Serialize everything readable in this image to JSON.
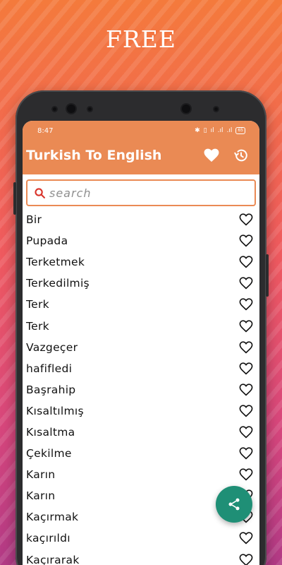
{
  "promo": {
    "title": "FREE"
  },
  "status_bar": {
    "time": "8:47",
    "battery": "65"
  },
  "app_bar": {
    "title": "Turkish To English"
  },
  "search": {
    "placeholder": "search",
    "value": ""
  },
  "words": [
    "Bir",
    "Pupada",
    "Terketmek",
    "Terkedilmiş",
    "Terk",
    "Terk",
    "Vazgeçer",
    "hafifledi",
    "Başrahip",
    "Kısaltılmış",
    "Kısaltma",
    "Çekilme",
    "Karın",
    "Karın",
    "Kaçırmak",
    "kaçırıldı",
    "Kaçırarak"
  ],
  "icons": {
    "favorites": "heart-filled-icon",
    "history": "history-icon",
    "search": "search-icon",
    "favorite_toggle": "heart-outline-icon",
    "share": "share-icon"
  },
  "colors": {
    "app_bar": "#ea8a54",
    "search_border": "#ea8a54",
    "search_icon": "#d9342b",
    "fab": "#1f8f76"
  }
}
